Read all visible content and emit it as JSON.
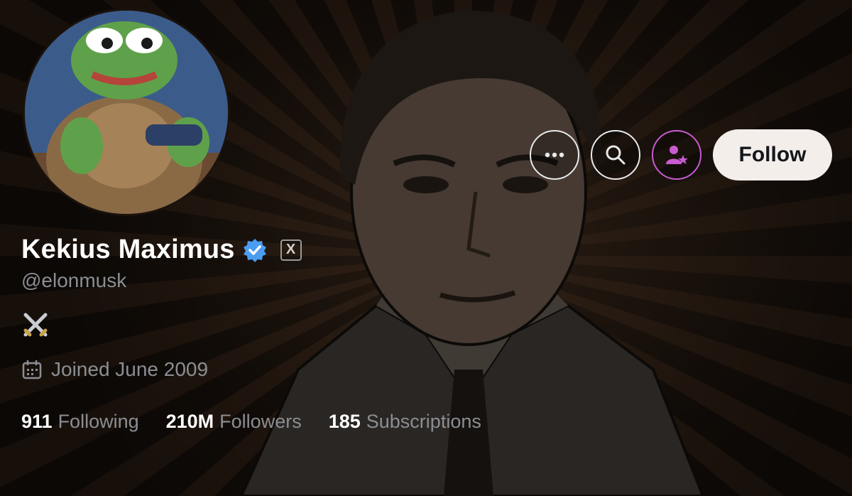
{
  "profile": {
    "name": "Kekius Maximus",
    "handle": "@elonmusk",
    "verified_icon": "verified-badge-icon",
    "affiliate_icon": "x-logo-icon",
    "affiliate_letter": "X",
    "bio_icon": "crossed-swords-icon",
    "joined": "Joined June 2009"
  },
  "actions": {
    "more_icon": "more-icon",
    "search_icon": "search-icon",
    "subscribe_icon": "subscribe-icon",
    "follow_label": "Follow"
  },
  "stats": [
    {
      "value": "911",
      "label": "Following"
    },
    {
      "value": "210M",
      "label": "Followers"
    },
    {
      "value": "185",
      "label": "Subscriptions"
    }
  ],
  "colors": {
    "verified": "#4a9df0",
    "subscribe_ring": "#c85bd0",
    "follow_bg": "#f4eeeb"
  }
}
